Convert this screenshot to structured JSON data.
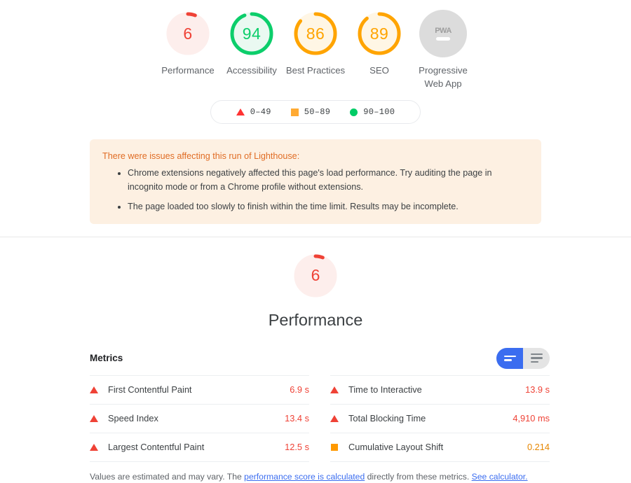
{
  "scores": [
    {
      "id": "performance",
      "label": "Performance",
      "value": "6",
      "percent": 6,
      "color": "#ef4236",
      "track": "#fdeeec",
      "type": "gauge"
    },
    {
      "id": "accessibility",
      "label": "Accessibility",
      "value": "94",
      "percent": 94,
      "color": "#0cce6b",
      "track": "#eaf9f1",
      "type": "gauge"
    },
    {
      "id": "best-practices",
      "label": "Best Practices",
      "value": "86",
      "percent": 86,
      "color": "#ffa400",
      "track": "#fff6e5",
      "type": "gauge"
    },
    {
      "id": "seo",
      "label": "SEO",
      "value": "89",
      "percent": 89,
      "color": "#ffa400",
      "track": "#fff6e5",
      "type": "gauge"
    },
    {
      "id": "pwa",
      "label": "Progressive Web App",
      "value": "PWA",
      "percent": 0,
      "color": "#9e9e9e",
      "track": "#dcdcdc",
      "type": "badge"
    }
  ],
  "legend": {
    "items": [
      {
        "shape": "triangle",
        "range": "0–49",
        "color": "#ff3333"
      },
      {
        "shape": "square",
        "range": "50–89",
        "color": "#ffaa33"
      },
      {
        "shape": "circle",
        "range": "90–100",
        "color": "#00cc66"
      }
    ]
  },
  "warnings": {
    "title": "There were issues affecting this run of Lighthouse:",
    "items": [
      "Chrome extensions negatively affected this page's load performance. Try auditing the page in incognito mode or from a Chrome profile without extensions.",
      "The page loaded too slowly to finish within the time limit. Results may be incomplete."
    ]
  },
  "category": {
    "title": "Performance",
    "score": "6",
    "percent": 6,
    "color": "#ef4236",
    "track": "#fdeeec"
  },
  "metrics": {
    "heading": "Metrics",
    "toggle": {
      "expand_label": "Collapse view",
      "collapse_label": "Expand view",
      "active_color": "#3b6df0",
      "inactive_color": "#e4e4e4"
    },
    "left": [
      {
        "name": "First Contentful Paint",
        "value": "6.9 s",
        "rating": "fail"
      },
      {
        "name": "Speed Index",
        "value": "13.4 s",
        "rating": "fail"
      },
      {
        "name": "Largest Contentful Paint",
        "value": "12.5 s",
        "rating": "fail"
      }
    ],
    "right": [
      {
        "name": "Time to Interactive",
        "value": "13.9 s",
        "rating": "fail"
      },
      {
        "name": "Total Blocking Time",
        "value": "4,910 ms",
        "rating": "fail"
      },
      {
        "name": "Cumulative Layout Shift",
        "value": "0.214",
        "rating": "average"
      }
    ]
  },
  "footnote": {
    "part1": "Values are estimated and may vary. The ",
    "link1": "performance score is calculated",
    "part2": " directly from these metrics. ",
    "link2": "See calculator."
  }
}
